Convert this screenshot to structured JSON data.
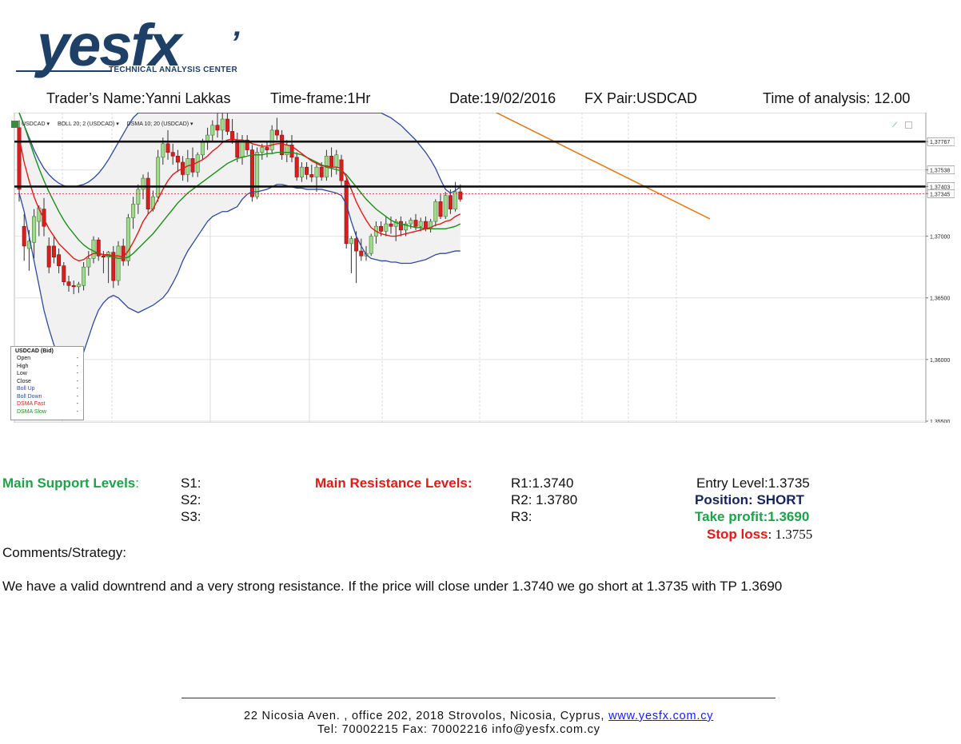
{
  "logo": {
    "word": "yesfx",
    "tick": "’",
    "subtitle": "TECHNICAL ANALYSIS CENTER"
  },
  "header": {
    "trader": "Trader’s Name:Yanni Lakkas",
    "timeframe": "Time-frame:1Hr",
    "date": "Date:19/02/2016",
    "pair": "FX Pair:USDCAD",
    "time": "Time of analysis: 12.00"
  },
  "chart_toolbar": {
    "symbol": "USDCAD ▾",
    "boll": "BOLL 20; 2 (USDCAD) ▾",
    "dsma": "DSMA 10; 20 (USDCAD) ▾"
  },
  "chart_data": {
    "type": "candlestick",
    "symbol": "USDCAD",
    "ylim": [
      1.355,
      1.3795
    ],
    "ytick_labels": [
      "1,37767",
      "1,37538",
      "1,37403",
      "1,37345",
      "1,37000",
      "1,36500",
      "1,36000",
      "1,35500"
    ],
    "ytick_values": [
      1.37767,
      1.37538,
      1.37403,
      1.37345,
      1.37,
      1.365,
      1.36,
      1.355
    ],
    "horizontal_levels": [
      1.37767,
      1.37403
    ],
    "current_price": 1.37345,
    "candles": [
      {
        "o": 1.3788,
        "h": 1.3794,
        "l": 1.3728,
        "c": 1.3738
      },
      {
        "o": 1.3708,
        "h": 1.3718,
        "l": 1.368,
        "c": 1.3692
      },
      {
        "o": 1.369,
        "h": 1.3705,
        "l": 1.3672,
        "c": 1.3696
      },
      {
        "o": 1.3695,
        "h": 1.3722,
        "l": 1.3682,
        "c": 1.3716
      },
      {
        "o": 1.3712,
        "h": 1.3725,
        "l": 1.37,
        "c": 1.3723
      },
      {
        "o": 1.3722,
        "h": 1.3731,
        "l": 1.37,
        "c": 1.3708
      },
      {
        "o": 1.3692,
        "h": 1.3699,
        "l": 1.367,
        "c": 1.3675
      },
      {
        "o": 1.3692,
        "h": 1.37,
        "l": 1.3678,
        "c": 1.3683
      },
      {
        "o": 1.3685,
        "h": 1.369,
        "l": 1.367,
        "c": 1.3676
      },
      {
        "o": 1.3676,
        "h": 1.3679,
        "l": 1.366,
        "c": 1.3663
      },
      {
        "o": 1.3663,
        "h": 1.3668,
        "l": 1.3655,
        "c": 1.366
      },
      {
        "o": 1.366,
        "h": 1.3664,
        "l": 1.3653,
        "c": 1.3659
      },
      {
        "o": 1.3659,
        "h": 1.3663,
        "l": 1.3654,
        "c": 1.3661
      },
      {
        "o": 1.366,
        "h": 1.3679,
        "l": 1.3656,
        "c": 1.3675
      },
      {
        "o": 1.3675,
        "h": 1.3688,
        "l": 1.3668,
        "c": 1.3682
      },
      {
        "o": 1.3682,
        "h": 1.37,
        "l": 1.3678,
        "c": 1.3697
      },
      {
        "o": 1.3697,
        "h": 1.3699,
        "l": 1.368,
        "c": 1.3684
      },
      {
        "o": 1.3684,
        "h": 1.3688,
        "l": 1.367,
        "c": 1.3683
      },
      {
        "o": 1.3683,
        "h": 1.3688,
        "l": 1.3662,
        "c": 1.3687
      },
      {
        "o": 1.3687,
        "h": 1.3692,
        "l": 1.3658,
        "c": 1.3664
      },
      {
        "o": 1.3664,
        "h": 1.3696,
        "l": 1.366,
        "c": 1.3692
      },
      {
        "o": 1.3692,
        "h": 1.3698,
        "l": 1.3676,
        "c": 1.368
      },
      {
        "o": 1.368,
        "h": 1.3718,
        "l": 1.3676,
        "c": 1.3715
      },
      {
        "o": 1.3715,
        "h": 1.3732,
        "l": 1.3706,
        "c": 1.3726
      },
      {
        "o": 1.3726,
        "h": 1.3742,
        "l": 1.3718,
        "c": 1.3738
      },
      {
        "o": 1.3738,
        "h": 1.375,
        "l": 1.373,
        "c": 1.3747
      },
      {
        "o": 1.3747,
        "h": 1.3752,
        "l": 1.3718,
        "c": 1.3722
      },
      {
        "o": 1.3722,
        "h": 1.3737,
        "l": 1.372,
        "c": 1.3732
      },
      {
        "o": 1.3732,
        "h": 1.377,
        "l": 1.3728,
        "c": 1.3764
      },
      {
        "o": 1.3764,
        "h": 1.378,
        "l": 1.3758,
        "c": 1.3775
      },
      {
        "o": 1.3775,
        "h": 1.3786,
        "l": 1.3762,
        "c": 1.3768
      },
      {
        "o": 1.3768,
        "h": 1.3775,
        "l": 1.3758,
        "c": 1.3765
      },
      {
        "o": 1.3765,
        "h": 1.377,
        "l": 1.3752,
        "c": 1.376
      },
      {
        "o": 1.376,
        "h": 1.3765,
        "l": 1.3745,
        "c": 1.375
      },
      {
        "o": 1.375,
        "h": 1.377,
        "l": 1.3744,
        "c": 1.3763
      },
      {
        "o": 1.3763,
        "h": 1.3772,
        "l": 1.3748,
        "c": 1.3752
      },
      {
        "o": 1.3752,
        "h": 1.3768,
        "l": 1.3748,
        "c": 1.3766
      },
      {
        "o": 1.3766,
        "h": 1.3779,
        "l": 1.3762,
        "c": 1.3776
      },
      {
        "o": 1.3776,
        "h": 1.3788,
        "l": 1.377,
        "c": 1.3782
      },
      {
        "o": 1.3782,
        "h": 1.3794,
        "l": 1.3776,
        "c": 1.379
      },
      {
        "o": 1.379,
        "h": 1.38,
        "l": 1.378,
        "c": 1.3786
      },
      {
        "o": 1.3786,
        "h": 1.38,
        "l": 1.3778,
        "c": 1.3795
      },
      {
        "o": 1.3795,
        "h": 1.38,
        "l": 1.3782,
        "c": 1.3785
      },
      {
        "o": 1.3785,
        "h": 1.3795,
        "l": 1.3775,
        "c": 1.3778
      },
      {
        "o": 1.3778,
        "h": 1.3784,
        "l": 1.376,
        "c": 1.3764
      },
      {
        "o": 1.3764,
        "h": 1.3782,
        "l": 1.3758,
        "c": 1.3778
      },
      {
        "o": 1.3778,
        "h": 1.3782,
        "l": 1.3766,
        "c": 1.377
      },
      {
        "o": 1.377,
        "h": 1.3774,
        "l": 1.3728,
        "c": 1.3732
      },
      {
        "o": 1.3732,
        "h": 1.3772,
        "l": 1.373,
        "c": 1.3768
      },
      {
        "o": 1.3768,
        "h": 1.3775,
        "l": 1.3762,
        "c": 1.3772
      },
      {
        "o": 1.3772,
        "h": 1.3776,
        "l": 1.3764,
        "c": 1.377
      },
      {
        "o": 1.377,
        "h": 1.379,
        "l": 1.3767,
        "c": 1.3786
      },
      {
        "o": 1.3786,
        "h": 1.3796,
        "l": 1.3778,
        "c": 1.3782
      },
      {
        "o": 1.3782,
        "h": 1.3786,
        "l": 1.3762,
        "c": 1.3766
      },
      {
        "o": 1.3766,
        "h": 1.3778,
        "l": 1.376,
        "c": 1.3774
      },
      {
        "o": 1.3774,
        "h": 1.3782,
        "l": 1.376,
        "c": 1.3764
      },
      {
        "o": 1.3764,
        "h": 1.3768,
        "l": 1.3745,
        "c": 1.3748
      },
      {
        "o": 1.3748,
        "h": 1.376,
        "l": 1.3744,
        "c": 1.3756
      },
      {
        "o": 1.3756,
        "h": 1.376,
        "l": 1.3746,
        "c": 1.375
      },
      {
        "o": 1.375,
        "h": 1.3758,
        "l": 1.3744,
        "c": 1.3748
      },
      {
        "o": 1.3748,
        "h": 1.376,
        "l": 1.3736,
        "c": 1.3756
      },
      {
        "o": 1.3756,
        "h": 1.376,
        "l": 1.3745,
        "c": 1.3748
      },
      {
        "o": 1.3748,
        "h": 1.377,
        "l": 1.3745,
        "c": 1.3765
      },
      {
        "o": 1.3765,
        "h": 1.3772,
        "l": 1.3748,
        "c": 1.3756
      },
      {
        "o": 1.3756,
        "h": 1.377,
        "l": 1.375,
        "c": 1.3766
      },
      {
        "o": 1.3762,
        "h": 1.3766,
        "l": 1.374,
        "c": 1.3745
      },
      {
        "o": 1.3745,
        "h": 1.3748,
        "l": 1.369,
        "c": 1.3694
      },
      {
        "o": 1.3694,
        "h": 1.37,
        "l": 1.367,
        "c": 1.3698
      },
      {
        "o": 1.3698,
        "h": 1.3704,
        "l": 1.3662,
        "c": 1.3688
      },
      {
        "o": 1.3688,
        "h": 1.3698,
        "l": 1.368,
        "c": 1.3684
      },
      {
        "o": 1.3684,
        "h": 1.3692,
        "l": 1.368,
        "c": 1.3686
      },
      {
        "o": 1.3686,
        "h": 1.3702,
        "l": 1.3684,
        "c": 1.37
      },
      {
        "o": 1.37,
        "h": 1.3712,
        "l": 1.3694,
        "c": 1.3708
      },
      {
        "o": 1.3708,
        "h": 1.3712,
        "l": 1.37,
        "c": 1.3704
      },
      {
        "o": 1.3704,
        "h": 1.3716,
        "l": 1.37,
        "c": 1.371
      },
      {
        "o": 1.371,
        "h": 1.3716,
        "l": 1.3702,
        "c": 1.3708
      },
      {
        "o": 1.3708,
        "h": 1.3714,
        "l": 1.3696,
        "c": 1.3712
      },
      {
        "o": 1.3712,
        "h": 1.3716,
        "l": 1.37,
        "c": 1.3705
      },
      {
        "o": 1.3705,
        "h": 1.3712,
        "l": 1.37,
        "c": 1.371
      },
      {
        "o": 1.371,
        "h": 1.3715,
        "l": 1.3706,
        "c": 1.3713
      },
      {
        "o": 1.3713,
        "h": 1.3718,
        "l": 1.3705,
        "c": 1.3708
      },
      {
        "o": 1.3708,
        "h": 1.3715,
        "l": 1.3704,
        "c": 1.3712
      },
      {
        "o": 1.3712,
        "h": 1.3716,
        "l": 1.3704,
        "c": 1.3706
      },
      {
        "o": 1.3706,
        "h": 1.3714,
        "l": 1.3703,
        "c": 1.3712
      },
      {
        "o": 1.3712,
        "h": 1.373,
        "l": 1.3708,
        "c": 1.3728
      },
      {
        "o": 1.3728,
        "h": 1.3734,
        "l": 1.3714,
        "c": 1.3716
      },
      {
        "o": 1.3716,
        "h": 1.3736,
        "l": 1.3714,
        "c": 1.3733
      },
      {
        "o": 1.3733,
        "h": 1.3738,
        "l": 1.3718,
        "c": 1.3722
      },
      {
        "o": 1.3722,
        "h": 1.3744,
        "l": 1.372,
        "c": 1.3736
      },
      {
        "o": 1.3736,
        "h": 1.3742,
        "l": 1.3728,
        "c": 1.373
      }
    ],
    "boll_up": [
      1.38,
      1.379,
      1.378,
      1.377,
      1.3762,
      1.3755,
      1.375,
      1.3746,
      1.3743,
      1.3741,
      1.374,
      1.374,
      1.3741,
      1.3742,
      1.3744,
      1.3747,
      1.3751,
      1.3756,
      1.3762,
      1.3769,
      1.3776,
      1.3783,
      1.379,
      1.3796,
      1.38,
      1.38,
      1.38,
      1.38,
      1.38,
      1.38,
      1.38,
      1.38,
      1.38,
      1.38,
      1.38,
      1.38,
      1.38,
      1.38,
      1.38,
      1.38,
      1.38,
      1.38,
      1.38,
      1.38,
      1.38,
      1.38,
      1.38,
      1.38,
      1.38,
      1.38,
      1.38,
      1.38,
      1.38,
      1.38,
      1.38,
      1.38,
      1.38,
      1.38,
      1.38,
      1.38,
      1.38,
      1.38,
      1.38,
      1.38,
      1.38,
      1.38,
      1.38,
      1.38,
      1.38,
      1.38,
      1.38,
      1.38,
      1.38,
      1.38,
      1.3798,
      1.3796,
      1.3793,
      1.379,
      1.3786,
      1.3782,
      1.3778,
      1.3773,
      1.3768,
      1.3762,
      1.3755,
      1.3746,
      1.3738,
      1.3735,
      1.3737,
      1.374
    ],
    "boll_down": [
      1.3735,
      1.372,
      1.37,
      1.368,
      1.366,
      1.364,
      1.3625,
      1.3612,
      1.3603,
      1.3597,
      1.3594,
      1.3594,
      1.3598,
      1.3606,
      1.3618,
      1.363,
      1.364,
      1.3646,
      1.365,
      1.3652,
      1.365,
      1.3646,
      1.3642,
      1.364,
      1.3638,
      1.364,
      1.3642,
      1.3644,
      1.3647,
      1.365,
      1.3655,
      1.3662,
      1.367,
      1.368,
      1.3688,
      1.3694,
      1.37,
      1.3706,
      1.3712,
      1.3716,
      1.3718,
      1.372,
      1.372,
      1.3722,
      1.3724,
      1.373,
      1.3734,
      1.3736,
      1.3736,
      1.3737,
      1.3738,
      1.374,
      1.3742,
      1.3742,
      1.3741,
      1.374,
      1.3739,
      1.3739,
      1.3738,
      1.3738,
      1.3738,
      1.3738,
      1.3737,
      1.3736,
      1.3735,
      1.3733,
      1.3726,
      1.3712,
      1.37,
      1.3692,
      1.3685,
      1.3682,
      1.3681,
      1.368,
      1.368,
      1.3679,
      1.3679,
      1.3678,
      1.3678,
      1.3678,
      1.3679,
      1.368,
      1.3681,
      1.3683,
      1.3685,
      1.3686,
      1.3686,
      1.3687,
      1.3688,
      1.3688
    ],
    "dsma_fast": [
      1.378,
      1.376,
      1.3745,
      1.3732,
      1.3722,
      1.3714,
      1.3706,
      1.37,
      1.3694,
      1.369,
      1.3686,
      1.3682,
      1.368,
      1.3681,
      1.3684,
      1.3686,
      1.3686,
      1.3685,
      1.3685,
      1.3684,
      1.3684,
      1.3683,
      1.3688,
      1.3695,
      1.3703,
      1.3712,
      1.3718,
      1.3722,
      1.373,
      1.3738,
      1.3745,
      1.375,
      1.3753,
      1.3755,
      1.3757,
      1.3758,
      1.376,
      1.3762,
      1.3765,
      1.3769,
      1.3772,
      1.3776,
      1.3778,
      1.3779,
      1.3778,
      1.3778,
      1.3777,
      1.3775,
      1.3774,
      1.3773,
      1.3773,
      1.3774,
      1.3775,
      1.3775,
      1.3774,
      1.3773,
      1.377,
      1.3767,
      1.3764,
      1.3761,
      1.3759,
      1.3757,
      1.3757,
      1.3756,
      1.3756,
      1.3755,
      1.3748,
      1.3738,
      1.3728,
      1.372,
      1.3713,
      1.3707,
      1.3704,
      1.3702,
      1.3701,
      1.37,
      1.37,
      1.3701,
      1.3702,
      1.3703,
      1.3704,
      1.3705,
      1.3706,
      1.3707,
      1.3709,
      1.371,
      1.3712,
      1.3713,
      1.3716,
      1.3718
    ],
    "dsma_slow": [
      1.38,
      1.379,
      1.3778,
      1.3766,
      1.3755,
      1.3745,
      1.3736,
      1.3728,
      1.372,
      1.3713,
      1.3707,
      1.3702,
      1.3697,
      1.3693,
      1.369,
      1.3688,
      1.3686,
      1.3685,
      1.3684,
      1.3683,
      1.3682,
      1.3682,
      1.3683,
      1.3686,
      1.369,
      1.3694,
      1.3698,
      1.3702,
      1.3707,
      1.3712,
      1.3717,
      1.3722,
      1.3727,
      1.3731,
      1.3735,
      1.3738,
      1.3741,
      1.3744,
      1.3747,
      1.375,
      1.3753,
      1.3756,
      1.3759,
      1.3761,
      1.3763,
      1.3764,
      1.3765,
      1.3766,
      1.3766,
      1.3766,
      1.3767,
      1.3767,
      1.3768,
      1.3768,
      1.3768,
      1.3768,
      1.3767,
      1.3766,
      1.3764,
      1.3762,
      1.376,
      1.3758,
      1.3756,
      1.3755,
      1.3754,
      1.3753,
      1.375,
      1.3745,
      1.374,
      1.3735,
      1.373,
      1.3726,
      1.3722,
      1.3719,
      1.3716,
      1.3713,
      1.3711,
      1.371,
      1.3709,
      1.3708,
      1.3707,
      1.3707,
      1.3706,
      1.3706,
      1.3706,
      1.3706,
      1.3706,
      1.3707,
      1.3708,
      1.371
    ],
    "trendline": [
      [
        1.3805,
        1.3714
      ]
    ],
    "legend": {
      "title": "USDCAD (Bid)",
      "rows": [
        {
          "name": "Open",
          "value": "-",
          "color": "#111111"
        },
        {
          "name": "High",
          "value": "-",
          "color": "#111111"
        },
        {
          "name": "Low",
          "value": "-",
          "color": "#111111"
        },
        {
          "name": "Close",
          "value": "-",
          "color": "#111111"
        },
        {
          "name": "Boll Up",
          "value": "-",
          "color": "#2e4a9c"
        },
        {
          "name": "Boll Down",
          "value": "-",
          "color": "#2e4a9c"
        },
        {
          "name": "DSMA Fast",
          "value": "-",
          "color": "#e11a1a"
        },
        {
          "name": "DSMA Slow",
          "value": "-",
          "color": "#1a8f1a"
        }
      ]
    },
    "colors": {
      "bull": "#9fd98c",
      "bear": "#d61f1f",
      "boll": "#2e4a9c",
      "fast": "#e11a1a",
      "slow": "#1a8f1a",
      "trend": "#e07a1c",
      "band_fill": "#f1f1f1"
    }
  },
  "levels": {
    "support_label": "Main Support Levels",
    "support_colon": ":",
    "s1": "S1:",
    "s2": "S2:",
    "s3": "S3:",
    "resistance_label": "Main Resistance  Levels:",
    "r1": "R1:1.3740",
    "r2": "R2: 1.3780",
    "r3": "R3:",
    "entry": "Entry Level:1.3735",
    "position": "Position: SHORT",
    "take_profit": "Take profit:1.3690",
    "stop_label": "Stop loss",
    "stop_value": ": 1.3755"
  },
  "comments": {
    "label": "Comments/Strategy:",
    "text": "We have a valid downtrend and a very strong resistance. If the price will close under 1.3740 we go short at 1.3735 with TP 1.3690"
  },
  "footer": {
    "address": "22 Nicosia Aven. ,  office 202,  2018 Strovolos,  Nicosia,  Cyprus,  ",
    "website": "www.yesfx.com.cy",
    "contact": "Tel:  70002215  Fax:  70002216  info@yesfx.com.cy"
  }
}
